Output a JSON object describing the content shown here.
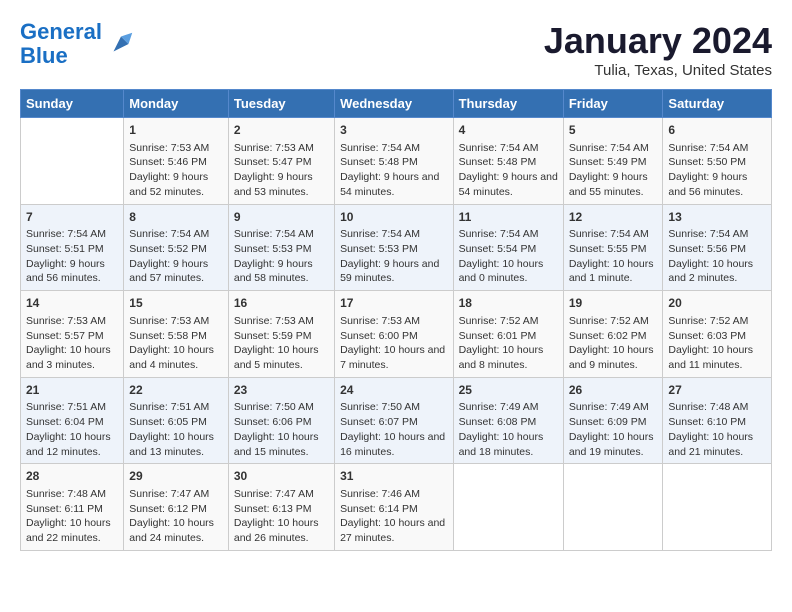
{
  "header": {
    "logo_line1": "General",
    "logo_line2": "Blue",
    "title": "January 2024",
    "subtitle": "Tulia, Texas, United States"
  },
  "days_of_week": [
    "Sunday",
    "Monday",
    "Tuesday",
    "Wednesday",
    "Thursday",
    "Friday",
    "Saturday"
  ],
  "weeks": [
    [
      {
        "day": "",
        "content": ""
      },
      {
        "day": "1",
        "content": "Sunrise: 7:53 AM\nSunset: 5:46 PM\nDaylight: 9 hours and 52 minutes."
      },
      {
        "day": "2",
        "content": "Sunrise: 7:53 AM\nSunset: 5:47 PM\nDaylight: 9 hours and 53 minutes."
      },
      {
        "day": "3",
        "content": "Sunrise: 7:54 AM\nSunset: 5:48 PM\nDaylight: 9 hours and 54 minutes."
      },
      {
        "day": "4",
        "content": "Sunrise: 7:54 AM\nSunset: 5:48 PM\nDaylight: 9 hours and 54 minutes."
      },
      {
        "day": "5",
        "content": "Sunrise: 7:54 AM\nSunset: 5:49 PM\nDaylight: 9 hours and 55 minutes."
      },
      {
        "day": "6",
        "content": "Sunrise: 7:54 AM\nSunset: 5:50 PM\nDaylight: 9 hours and 56 minutes."
      }
    ],
    [
      {
        "day": "7",
        "content": "Sunrise: 7:54 AM\nSunset: 5:51 PM\nDaylight: 9 hours and 56 minutes."
      },
      {
        "day": "8",
        "content": "Sunrise: 7:54 AM\nSunset: 5:52 PM\nDaylight: 9 hours and 57 minutes."
      },
      {
        "day": "9",
        "content": "Sunrise: 7:54 AM\nSunset: 5:53 PM\nDaylight: 9 hours and 58 minutes."
      },
      {
        "day": "10",
        "content": "Sunrise: 7:54 AM\nSunset: 5:53 PM\nDaylight: 9 hours and 59 minutes."
      },
      {
        "day": "11",
        "content": "Sunrise: 7:54 AM\nSunset: 5:54 PM\nDaylight: 10 hours and 0 minutes."
      },
      {
        "day": "12",
        "content": "Sunrise: 7:54 AM\nSunset: 5:55 PM\nDaylight: 10 hours and 1 minute."
      },
      {
        "day": "13",
        "content": "Sunrise: 7:54 AM\nSunset: 5:56 PM\nDaylight: 10 hours and 2 minutes."
      }
    ],
    [
      {
        "day": "14",
        "content": "Sunrise: 7:53 AM\nSunset: 5:57 PM\nDaylight: 10 hours and 3 minutes."
      },
      {
        "day": "15",
        "content": "Sunrise: 7:53 AM\nSunset: 5:58 PM\nDaylight: 10 hours and 4 minutes."
      },
      {
        "day": "16",
        "content": "Sunrise: 7:53 AM\nSunset: 5:59 PM\nDaylight: 10 hours and 5 minutes."
      },
      {
        "day": "17",
        "content": "Sunrise: 7:53 AM\nSunset: 6:00 PM\nDaylight: 10 hours and 7 minutes."
      },
      {
        "day": "18",
        "content": "Sunrise: 7:52 AM\nSunset: 6:01 PM\nDaylight: 10 hours and 8 minutes."
      },
      {
        "day": "19",
        "content": "Sunrise: 7:52 AM\nSunset: 6:02 PM\nDaylight: 10 hours and 9 minutes."
      },
      {
        "day": "20",
        "content": "Sunrise: 7:52 AM\nSunset: 6:03 PM\nDaylight: 10 hours and 11 minutes."
      }
    ],
    [
      {
        "day": "21",
        "content": "Sunrise: 7:51 AM\nSunset: 6:04 PM\nDaylight: 10 hours and 12 minutes."
      },
      {
        "day": "22",
        "content": "Sunrise: 7:51 AM\nSunset: 6:05 PM\nDaylight: 10 hours and 13 minutes."
      },
      {
        "day": "23",
        "content": "Sunrise: 7:50 AM\nSunset: 6:06 PM\nDaylight: 10 hours and 15 minutes."
      },
      {
        "day": "24",
        "content": "Sunrise: 7:50 AM\nSunset: 6:07 PM\nDaylight: 10 hours and 16 minutes."
      },
      {
        "day": "25",
        "content": "Sunrise: 7:49 AM\nSunset: 6:08 PM\nDaylight: 10 hours and 18 minutes."
      },
      {
        "day": "26",
        "content": "Sunrise: 7:49 AM\nSunset: 6:09 PM\nDaylight: 10 hours and 19 minutes."
      },
      {
        "day": "27",
        "content": "Sunrise: 7:48 AM\nSunset: 6:10 PM\nDaylight: 10 hours and 21 minutes."
      }
    ],
    [
      {
        "day": "28",
        "content": "Sunrise: 7:48 AM\nSunset: 6:11 PM\nDaylight: 10 hours and 22 minutes."
      },
      {
        "day": "29",
        "content": "Sunrise: 7:47 AM\nSunset: 6:12 PM\nDaylight: 10 hours and 24 minutes."
      },
      {
        "day": "30",
        "content": "Sunrise: 7:47 AM\nSunset: 6:13 PM\nDaylight: 10 hours and 26 minutes."
      },
      {
        "day": "31",
        "content": "Sunrise: 7:46 AM\nSunset: 6:14 PM\nDaylight: 10 hours and 27 minutes."
      },
      {
        "day": "",
        "content": ""
      },
      {
        "day": "",
        "content": ""
      },
      {
        "day": "",
        "content": ""
      }
    ]
  ]
}
